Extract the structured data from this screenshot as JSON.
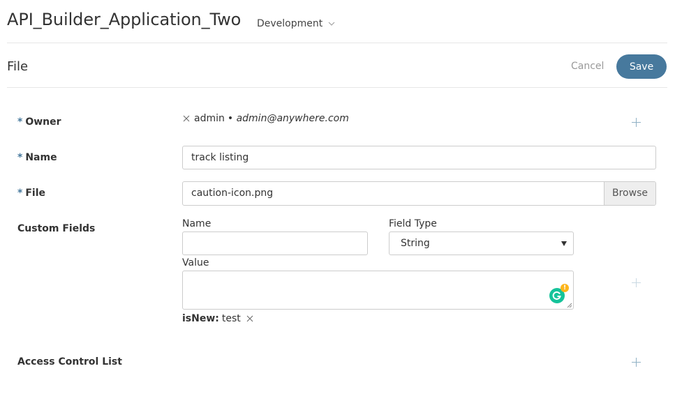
{
  "header": {
    "app_title": "API_Builder_Application_Two",
    "environment": "Development"
  },
  "page": {
    "title": "File",
    "cancel_label": "Cancel",
    "save_label": "Save"
  },
  "form": {
    "owner": {
      "required_mark": "*",
      "label": "Owner",
      "user_name": "admin",
      "user_email": "• admin@anywhere.com"
    },
    "name": {
      "required_mark": "*",
      "label": "Name",
      "value": "track listing"
    },
    "file": {
      "required_mark": "*",
      "label": "File",
      "value": "caution-icon.png",
      "browse_label": "Browse"
    },
    "custom_fields": {
      "label": "Custom Fields",
      "name_label": "Name",
      "name_value": "",
      "field_type_label": "Field Type",
      "field_type_value": "String",
      "value_label": "Value",
      "value_text": "",
      "existing": [
        {
          "key": "isNew:",
          "value": "test"
        }
      ]
    },
    "acl": {
      "label": "Access Control List"
    }
  },
  "icons": {
    "remove": "close-icon",
    "add": "plus-icon",
    "dropdown": "chevron-down-icon",
    "grammarly": "grammarly-icon"
  },
  "colors": {
    "accent": "#47799d",
    "save_text": "#ffffff",
    "cancel_text": "#999999",
    "grammarly_green": "#15c39a",
    "grammarly_badge": "#fdb51b"
  }
}
